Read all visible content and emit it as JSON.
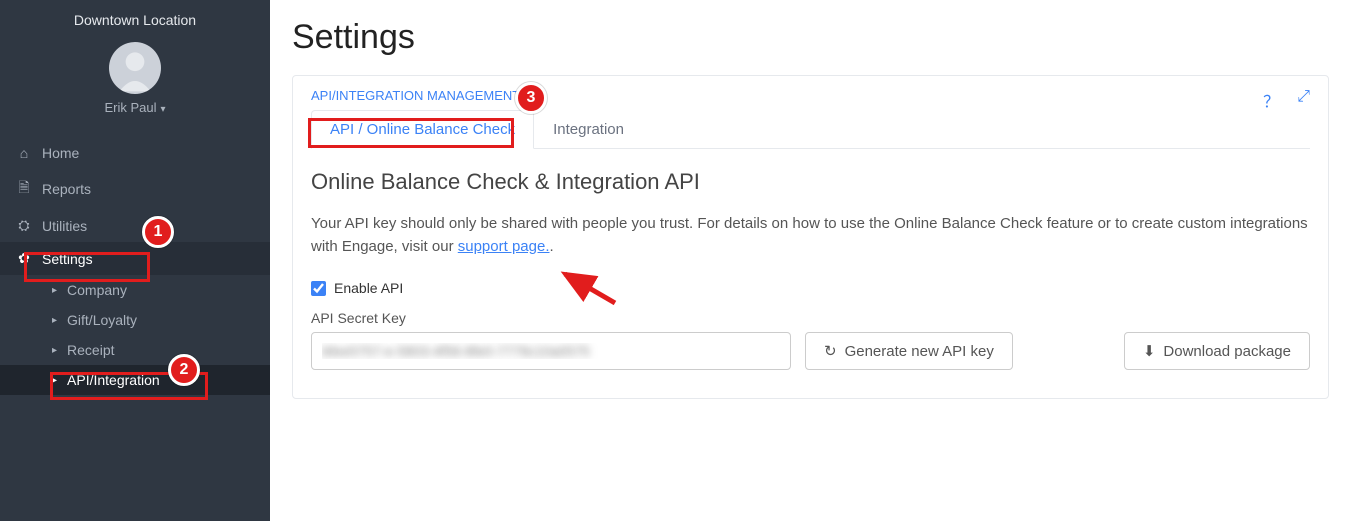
{
  "location": "Downtown Location",
  "user": "Erik Paul",
  "nav": {
    "home": "Home",
    "reports": "Reports",
    "utilities": "Utilities",
    "settings": "Settings",
    "settings_children": {
      "company": "Company",
      "gift": "Gift/Loyalty",
      "receipt": "Receipt",
      "api": "API/Integration"
    }
  },
  "page": {
    "title": "Settings",
    "section_label": "API/INTEGRATION MANAGEMENT",
    "tabs": {
      "api": "API / Online Balance Check",
      "integration": "Integration"
    },
    "heading": "Online Balance Check & Integration API",
    "desc_1": "Your API key should only be shared with people you trust. For details on how to use the Online Balance Check feature or to create custom integrations with Engage, visit our ",
    "support_link": "support page.",
    "desc_2": ".",
    "enable_api": "Enable API",
    "secret_label": "API Secret Key",
    "secret_value": "bfee5757-e-5803-4f56-8fe0-7779c10a0575",
    "gen_btn": "Generate new API key",
    "dl_btn": "Download package"
  },
  "annotations": {
    "b1": "1",
    "b2": "2",
    "b3": "3"
  }
}
